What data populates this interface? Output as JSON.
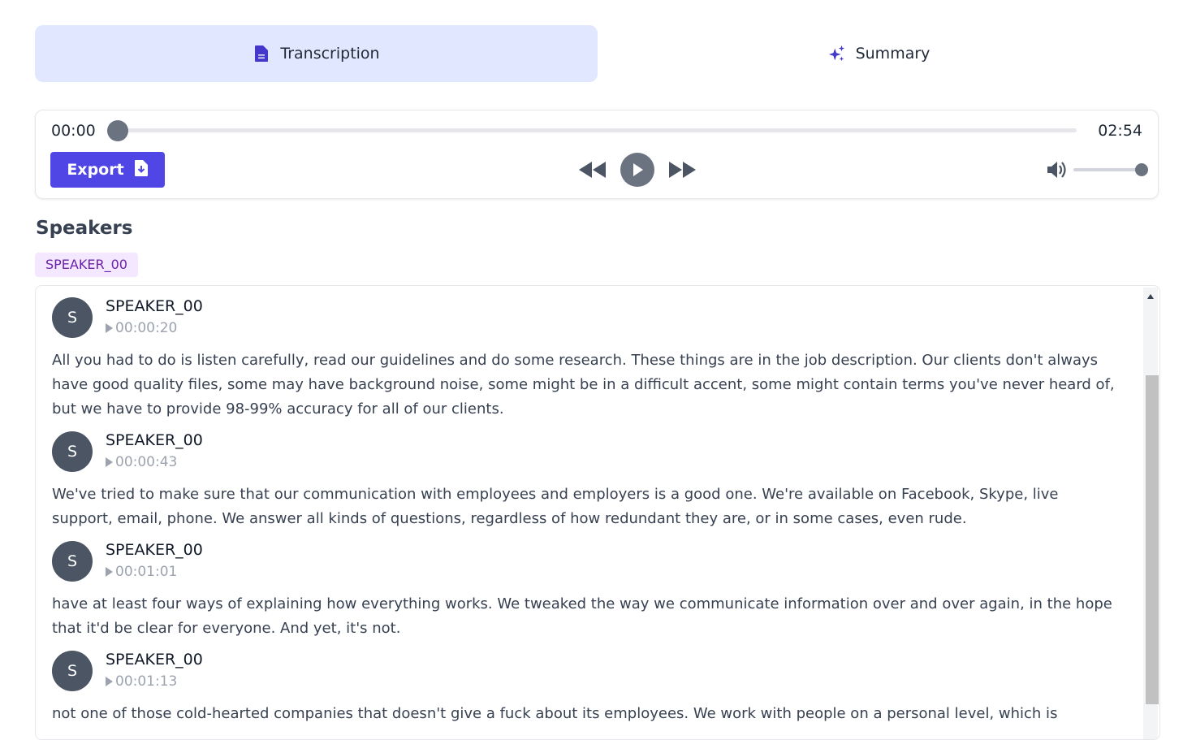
{
  "tabs": [
    {
      "label": "Transcription",
      "icon": "document-icon",
      "active": true
    },
    {
      "label": "Summary",
      "icon": "sparkles-icon",
      "active": false
    }
  ],
  "player": {
    "current_time": "00:00",
    "duration": "02:54",
    "progress": 0,
    "volume": 1.0,
    "export_label": "Export",
    "export_icon": "file-download-icon"
  },
  "speakers": {
    "title": "Speakers",
    "list": [
      "SPEAKER_00"
    ]
  },
  "transcript": [
    {
      "avatar": "S",
      "speaker": "SPEAKER_00",
      "timestamp": "00:00:20",
      "text": "All you had to do is listen carefully, read our guidelines and do some research. These things are in the job description. Our clients don't always have good quality files, some may have background noise, some might be in a difficult accent, some might contain terms you've never heard of, but we have to provide 98-99% accuracy for all of our clients."
    },
    {
      "avatar": "S",
      "speaker": "SPEAKER_00",
      "timestamp": "00:00:43",
      "text": "We've tried to make sure that our communication with employees and employers is a good one. We're available on Facebook, Skype, live support, email, phone. We answer all kinds of questions, regardless of how redundant they are, or in some cases, even rude."
    },
    {
      "avatar": "S",
      "speaker": "SPEAKER_00",
      "timestamp": "00:01:01",
      "text": "have at least four ways of explaining how everything works. We tweaked the way we communicate information over and over again, in the hope that it'd be clear for everyone. And yet, it's not."
    },
    {
      "avatar": "S",
      "speaker": "SPEAKER_00",
      "timestamp": "00:01:13",
      "text": "not one of those cold-hearted companies that doesn't give a fuck about its employees. We work with people on a personal level, which is"
    }
  ],
  "colors": {
    "accent": "#4f46e5",
    "tab_active_bg": "#e0e7ff",
    "chip_bg": "#f3e8ff",
    "chip_text": "#6b21a8",
    "avatar_bg": "#4b5563"
  }
}
